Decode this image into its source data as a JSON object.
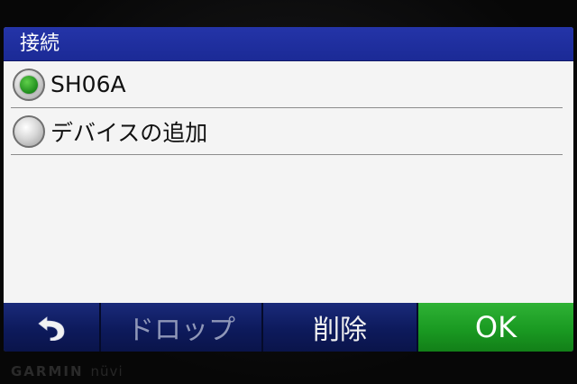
{
  "screen": {
    "title": "接続"
  },
  "list": {
    "items": [
      {
        "label": "SH06A",
        "selected": true
      },
      {
        "label": "デバイスの追加",
        "selected": false
      }
    ]
  },
  "toolbar": {
    "back_icon": "back-arrow-icon",
    "drop_label": "ドロップ",
    "delete_label": "削除",
    "ok_label": "OK"
  },
  "brand": {
    "name": "GARMIN",
    "model": "nüvi"
  },
  "colors": {
    "title_bar": "#1b2a96",
    "toolbar": "#0d1a5c",
    "ok_button": "#1a9a22",
    "radio_selected": "#1e8c1c",
    "list_background": "#f4f4f4"
  }
}
